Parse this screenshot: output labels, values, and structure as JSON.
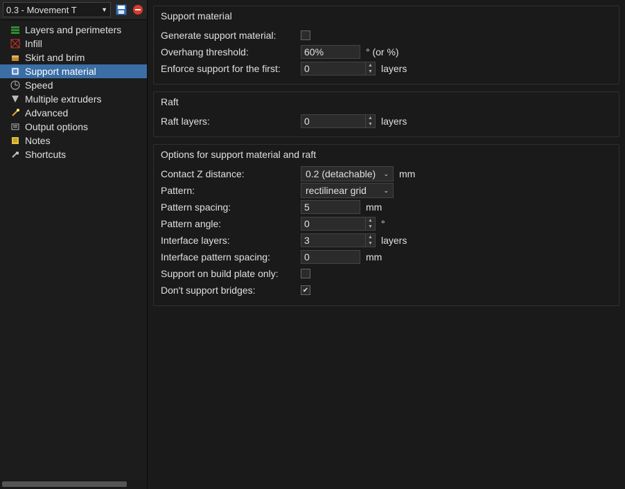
{
  "header": {
    "profile": "0.3 - Movement T"
  },
  "sidebar": {
    "items": [
      {
        "label": "Layers and perimeters",
        "icon": "layers-icon",
        "color": "#2e8b2e"
      },
      {
        "label": "Infill",
        "icon": "infill-icon",
        "color": "#d0342c"
      },
      {
        "label": "Skirt and brim",
        "icon": "skirt-icon",
        "color": "#c58a2d"
      },
      {
        "label": "Support material",
        "icon": "support-icon",
        "color": "#5a8fc7"
      },
      {
        "label": "Speed",
        "icon": "speed-icon",
        "color": "#bbb"
      },
      {
        "label": "Multiple extruders",
        "icon": "extruders-icon",
        "color": "#bbb"
      },
      {
        "label": "Advanced",
        "icon": "advanced-icon",
        "color": "#e5a83c"
      },
      {
        "label": "Output options",
        "icon": "output-icon",
        "color": "#bbb"
      },
      {
        "label": "Notes",
        "icon": "notes-icon",
        "color": "#e5c23c"
      },
      {
        "label": "Shortcuts",
        "icon": "shortcuts-icon",
        "color": "#bbb"
      }
    ],
    "selected_index": 3
  },
  "groups": {
    "support": {
      "title": "Support material",
      "generate_label": "Generate support material:",
      "generate_checked": false,
      "overhang_label": "Overhang threshold:",
      "overhang_value": "60%",
      "overhang_unit": "° (or %)",
      "enforce_label": "Enforce support for the first:",
      "enforce_value": "0",
      "enforce_unit": "layers"
    },
    "raft": {
      "title": "Raft",
      "layers_label": "Raft layers:",
      "layers_value": "0",
      "layers_unit": "layers"
    },
    "options": {
      "title": "Options for support material and raft",
      "contactz_label": "Contact Z distance:",
      "contactz_value": "0.2 (detachable)",
      "contactz_unit": "mm",
      "pattern_label": "Pattern:",
      "pattern_value": "rectilinear grid",
      "spacing_label": "Pattern spacing:",
      "spacing_value": "5",
      "spacing_unit": "mm",
      "angle_label": "Pattern angle:",
      "angle_value": "0",
      "angle_unit": "°",
      "iflayers_label": "Interface layers:",
      "iflayers_value": "3",
      "iflayers_unit": "layers",
      "ifspacing_label": "Interface pattern spacing:",
      "ifspacing_value": "0",
      "ifspacing_unit": "mm",
      "plateonly_label": "Support on build plate only:",
      "plateonly_checked": false,
      "nobridges_label": "Don't support bridges:",
      "nobridges_checked": true
    }
  }
}
